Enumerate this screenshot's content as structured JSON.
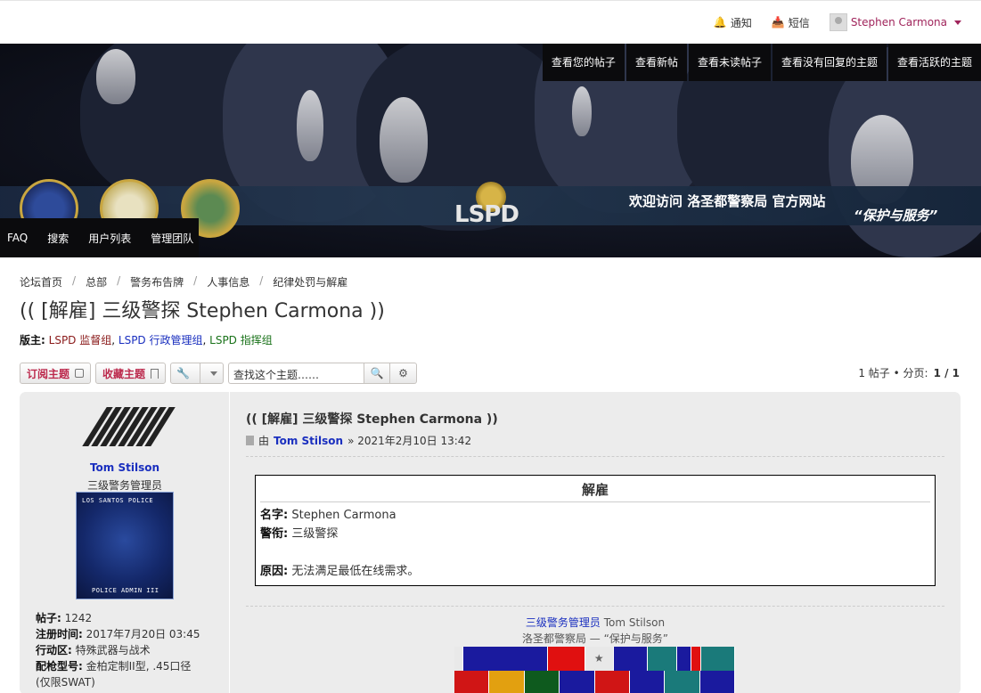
{
  "topbar": {
    "notifications_label": "通知",
    "messages_label": "短信",
    "username": "Stephen Carmona"
  },
  "banner": {
    "nav_items": [
      "查看您的帖子",
      "查看新帖",
      "查看未读帖子",
      "查看没有回复的主题",
      "查看活跃的主题"
    ],
    "welcome": "欢迎访问 洛圣都警察局 官方网站",
    "slogan": "“保护与服务”",
    "logo_text": "LSPD",
    "left_nav": [
      "FAQ",
      "搜索",
      "用户列表",
      "管理团队"
    ]
  },
  "breadcrumb": [
    "论坛首页",
    "总部",
    "警务布告牌",
    "人事信息",
    "纪律处罚与解雇"
  ],
  "page_title": "(( [解雇] 三级警探 Stephen Carmona ))",
  "moderators": {
    "label": "版主:",
    "groups": [
      "LSPD 监督组",
      "LSPD 行政管理组",
      "LSPD 指挥组"
    ]
  },
  "actions": {
    "subscribe": "订阅主题",
    "bookmark": "收藏主题",
    "search_placeholder": "查找这个主题……",
    "pagination_prefix": "1 帖子 • 分页:",
    "pagination_value": "1 / 1"
  },
  "post": {
    "author": {
      "name": "Tom Stilson",
      "rank": "三级警务管理员",
      "avatar_top": "LOS SANTOS POLICE",
      "avatar_bottom": "POLICE ADMIN III",
      "stats": [
        {
          "label": "帖子:",
          "value": "1242"
        },
        {
          "label": "注册时间:",
          "value": "2017年7月20日 03:45"
        },
        {
          "label": "行动区:",
          "value": "特殊武器与战术"
        },
        {
          "label": "配枪型号:",
          "value": "金柏定制II型, .45口径"
        }
      ],
      "stat_extra": "(仅限SWAT)"
    },
    "title": "(( [解雇] 三级警探 Stephen Carmona ))",
    "meta_by": "由",
    "meta_author": "Tom Stilson",
    "meta_date": "» 2021年2月10日 13:42",
    "content": {
      "heading": "解雇",
      "name_label": "名字:",
      "name_value": "Stephen Carmona",
      "rank_label": "警衔:",
      "rank_value": "三级警探",
      "reason_label": "原因:",
      "reason_value": "无法满足最低在线需求。"
    },
    "signature": {
      "rank": "三级警务管理员",
      "name": "Tom Stilson",
      "line2": "洛圣都警察局 — “保护与服务”"
    }
  },
  "colors": {
    "accent_red": "#bc2a4d",
    "link_blue": "#1a2fbf",
    "user_pink": "#a0245b",
    "mod_green": "#197219"
  }
}
